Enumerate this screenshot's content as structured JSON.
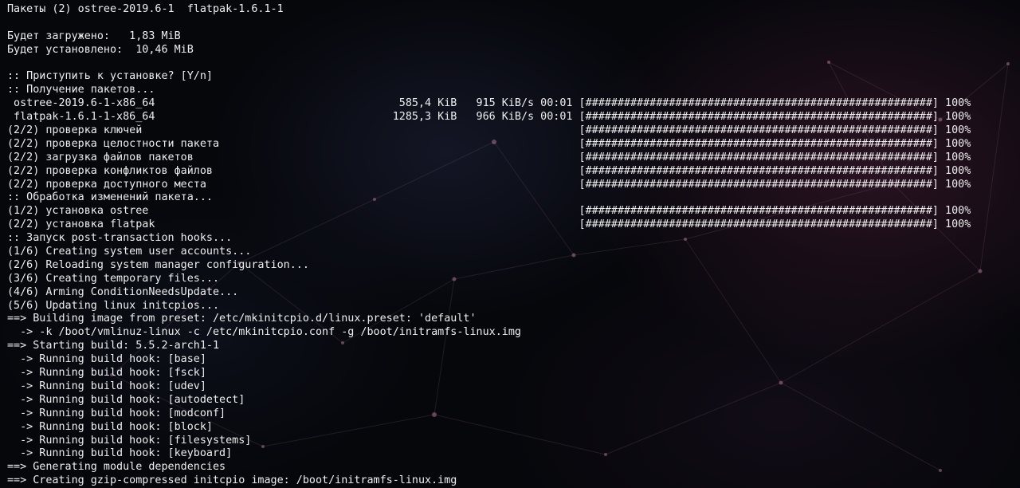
{
  "lines": [
    "Пакеты (2) ostree-2019.6-1  flatpak-1.6.1-1",
    "",
    "Будет загружено:   1,83 MiB",
    "Будет установлено:  10,46 MiB",
    "",
    ":: Приступить к установке? [Y/n]",
    ":: Получение пакетов...",
    " ostree-2019.6-1-x86_64                                      585,4 KiB   915 KiB/s 00:01 [######################################################] 100%",
    " flatpak-1.6.1-1-x86_64                                     1285,3 KiB   966 KiB/s 00:01 [######################################################] 100%",
    "(2/2) проверка ключей                                                                    [######################################################] 100%",
    "(2/2) проверка целостности пакета                                                        [######################################################] 100%",
    "(2/2) загрузка файлов пакетов                                                            [######################################################] 100%",
    "(2/2) проверка конфликтов файлов                                                         [######################################################] 100%",
    "(2/2) проверка доступного места                                                          [######################################################] 100%",
    ":: Обработка изменений пакета...",
    "(1/2) установка ostree                                                                   [######################################################] 100%",
    "(2/2) установка flatpak                                                                  [######################################################] 100%",
    ":: Запуск post-transaction hooks...",
    "(1/6) Creating system user accounts...",
    "(2/6) Reloading system manager configuration...",
    "(3/6) Creating temporary files...",
    "(4/6) Arming ConditionNeedsUpdate...",
    "(5/6) Updating linux initcpios...",
    "==> Building image from preset: /etc/mkinitcpio.d/linux.preset: 'default'",
    "  -> -k /boot/vmlinuz-linux -c /etc/mkinitcpio.conf -g /boot/initramfs-linux.img",
    "==> Starting build: 5.5.2-arch1-1",
    "  -> Running build hook: [base]",
    "  -> Running build hook: [fsck]",
    "  -> Running build hook: [udev]",
    "  -> Running build hook: [autodetect]",
    "  -> Running build hook: [modconf]",
    "  -> Running build hook: [block]",
    "  -> Running build hook: [filesystems]",
    "  -> Running build hook: [keyboard]",
    "==> Generating module dependencies",
    "==> Creating gzip-compressed initcpio image: /boot/initramfs-linux.img"
  ],
  "colors": {
    "text": "#eeeeee",
    "background": "#06070b"
  }
}
